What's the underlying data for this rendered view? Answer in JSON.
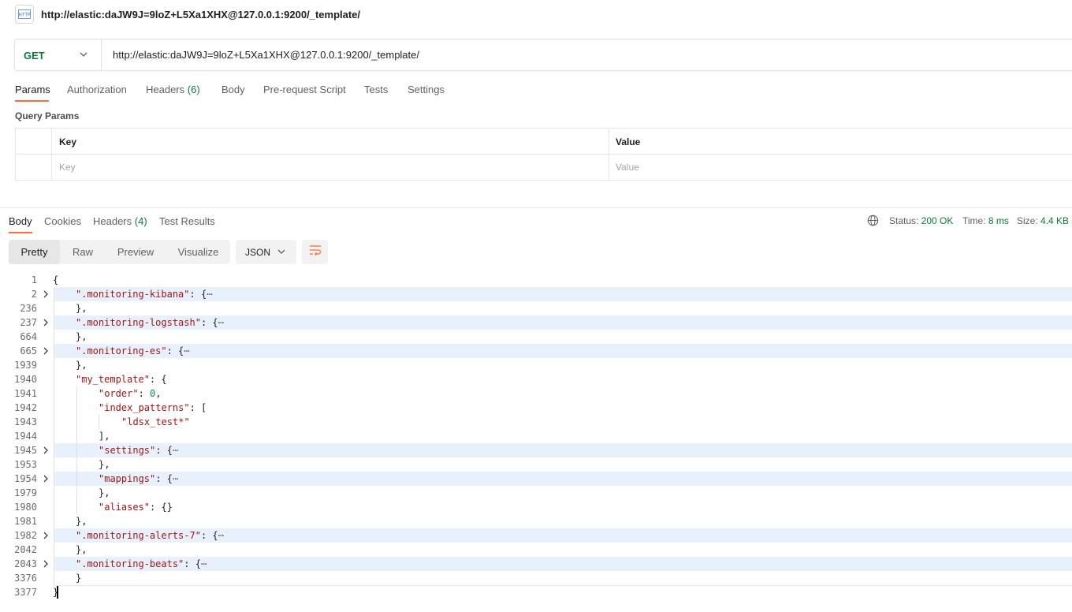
{
  "request": {
    "title": "http://elastic:daJW9J=9loZ+L5Xa1XHX@127.0.0.1:9200/_template/",
    "method": "GET",
    "url": "http://elastic:daJW9J=9loZ+L5Xa1XHX@127.0.0.1:9200/_template/"
  },
  "request_tabs": [
    {
      "label": "Params",
      "active": true
    },
    {
      "label": "Authorization"
    },
    {
      "label": "Headers",
      "count": "(6)"
    },
    {
      "label": "Body"
    },
    {
      "label": "Pre-request Script"
    },
    {
      "label": "Tests"
    },
    {
      "label": "Settings"
    }
  ],
  "query_params": {
    "label": "Query Params",
    "headers": {
      "key": "Key",
      "value": "Value"
    },
    "placeholders": {
      "key": "Key",
      "value": "Value"
    }
  },
  "response_tabs": [
    {
      "label": "Body",
      "active": true
    },
    {
      "label": "Cookies"
    },
    {
      "label": "Headers",
      "count": "(4)"
    },
    {
      "label": "Test Results"
    }
  ],
  "status": {
    "status_label": "Status:",
    "status_value": "200 OK",
    "time_label": "Time:",
    "time_value": "8 ms",
    "size_label": "Size:",
    "size_value": "4.4 KB"
  },
  "view": {
    "modes": [
      "Pretty",
      "Raw",
      "Preview",
      "Visualize"
    ],
    "active": "Pretty",
    "format": "JSON"
  },
  "code_lines": [
    {
      "n": "1",
      "text": "{"
    },
    {
      "n": "2",
      "key": ".monitoring-kibana",
      "folded": true
    },
    {
      "n": "236",
      "text": "},"
    },
    {
      "n": "237",
      "key": ".monitoring-logstash",
      "folded": true
    },
    {
      "n": "664",
      "text": "},"
    },
    {
      "n": "665",
      "key": ".monitoring-es",
      "folded": true
    },
    {
      "n": "1939",
      "text": "},"
    },
    {
      "n": "1940",
      "key": "my_template",
      "tail": ": {"
    },
    {
      "n": "1941",
      "key": "order",
      "tail": ": ",
      "num": "0",
      "after": ","
    },
    {
      "n": "1942",
      "key": "index_patterns",
      "tail": ": ["
    },
    {
      "n": "1943",
      "key": "ldsx_test*"
    },
    {
      "n": "1944",
      "text": "],"
    },
    {
      "n": "1945",
      "key": "settings",
      "folded": true
    },
    {
      "n": "1953",
      "text": "},"
    },
    {
      "n": "1954",
      "key": "mappings",
      "folded": true
    },
    {
      "n": "1979",
      "text": "},"
    },
    {
      "n": "1980",
      "key": "aliases",
      "tail": ": {}"
    },
    {
      "n": "1981",
      "text": "},"
    },
    {
      "n": "1982",
      "key": ".monitoring-alerts-7",
      "folded": true
    },
    {
      "n": "2042",
      "text": "},"
    },
    {
      "n": "2043",
      "key": ".monitoring-beats",
      "folded": true
    },
    {
      "n": "3376",
      "text": "}"
    },
    {
      "n": "3377",
      "text": "}"
    }
  ],
  "colors": {
    "accent": "#ff6c37",
    "success": "#0b7a3b",
    "json_key": "#a31515",
    "highlight": "#e8f1fb"
  }
}
